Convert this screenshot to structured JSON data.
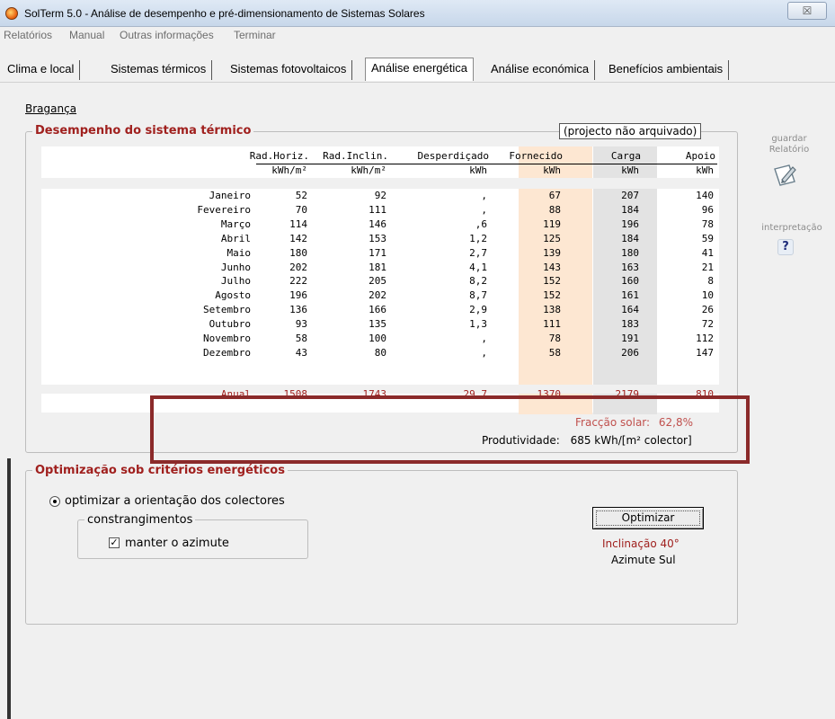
{
  "window": {
    "title": "SolTerm 5.0 - Análise de desempenho e pré-dimensionamento de Sistemas Solares",
    "close_glyph": "☒"
  },
  "menu": [
    {
      "label": "Relatórios"
    },
    {
      "label": "Manual"
    },
    {
      "label": "Outras informações"
    },
    {
      "label": "Terminar"
    }
  ],
  "tabs": [
    {
      "label": "Clima e local"
    },
    {
      "label": "Sistemas térmicos"
    },
    {
      "label": "Sistemas fotovoltaicos"
    },
    {
      "label": "Análise energética"
    },
    {
      "label": "Análise económica"
    },
    {
      "label": "Benefícios ambientais"
    }
  ],
  "location": "Bragança",
  "performance": {
    "title": "Desempenho do sistema térmico",
    "status": "(projecto não arquivado)",
    "headers": [
      "Rad.Horiz.",
      "Rad.Inclin.",
      "Desperdiçado",
      "Fornecido",
      "Carga",
      "Apoio"
    ],
    "units": [
      "kWh/m²",
      "kWh/m²",
      "kWh",
      "kWh",
      "kWh",
      "kWh"
    ],
    "rows": [
      {
        "month": "Janeiro",
        "values": [
          "52",
          "92",
          ",",
          "67",
          "207",
          "140"
        ]
      },
      {
        "month": "Fevereiro",
        "values": [
          "70",
          "111",
          ",",
          "88",
          "184",
          "96"
        ]
      },
      {
        "month": "Março",
        "values": [
          "114",
          "146",
          ",6",
          "119",
          "196",
          "78"
        ]
      },
      {
        "month": "Abril",
        "values": [
          "142",
          "153",
          "1,2",
          "125",
          "184",
          "59"
        ]
      },
      {
        "month": "Maio",
        "values": [
          "180",
          "171",
          "2,7",
          "139",
          "180",
          "41"
        ]
      },
      {
        "month": "Junho",
        "values": [
          "202",
          "181",
          "4,1",
          "143",
          "163",
          "21"
        ]
      },
      {
        "month": "Julho",
        "values": [
          "222",
          "205",
          "8,2",
          "152",
          "160",
          "8"
        ]
      },
      {
        "month": "Agosto",
        "values": [
          "196",
          "202",
          "8,7",
          "152",
          "161",
          "10"
        ]
      },
      {
        "month": "Setembro",
        "values": [
          "136",
          "166",
          "2,9",
          "138",
          "164",
          "26"
        ]
      },
      {
        "month": "Outubro",
        "values": [
          "93",
          "135",
          "1,3",
          "111",
          "183",
          "72"
        ]
      },
      {
        "month": "Novembro",
        "values": [
          "58",
          "100",
          ",",
          "78",
          "191",
          "112"
        ]
      },
      {
        "month": "Dezembro",
        "values": [
          "43",
          "80",
          ",",
          "58",
          "206",
          "147"
        ]
      }
    ],
    "annual": {
      "month": "Anual",
      "values": [
        "1508",
        "1743",
        "29,7",
        "1370",
        "2179",
        "810"
      ]
    },
    "solar_fraction_label": "Fracção solar:",
    "solar_fraction_value": "62,8%",
    "productivity_label": "Produtividade:",
    "productivity_value": "685 kWh/[m² colector]"
  },
  "sidebar": {
    "save_label": "guardar\nRelatório",
    "help_label": "interpretação",
    "help_glyph": "?"
  },
  "optimization": {
    "title": "Optimização sob critérios energéticos",
    "radio_label": "optimizar a orientação dos colectores",
    "constraints_title": "constrangimentos",
    "checkbox_label": "manter o azimute",
    "checkbox_glyph": "✓",
    "button_label": "Optimizar",
    "result_inclination": "Inclinação 40°",
    "result_azimuth": "Azimute Sul"
  },
  "colors": {
    "accent_red": "#a0201e",
    "fornecido_bg": "#fde7d2",
    "carga_bg": "#e3e3e3",
    "annotation_rect": "#8b2a2a"
  }
}
